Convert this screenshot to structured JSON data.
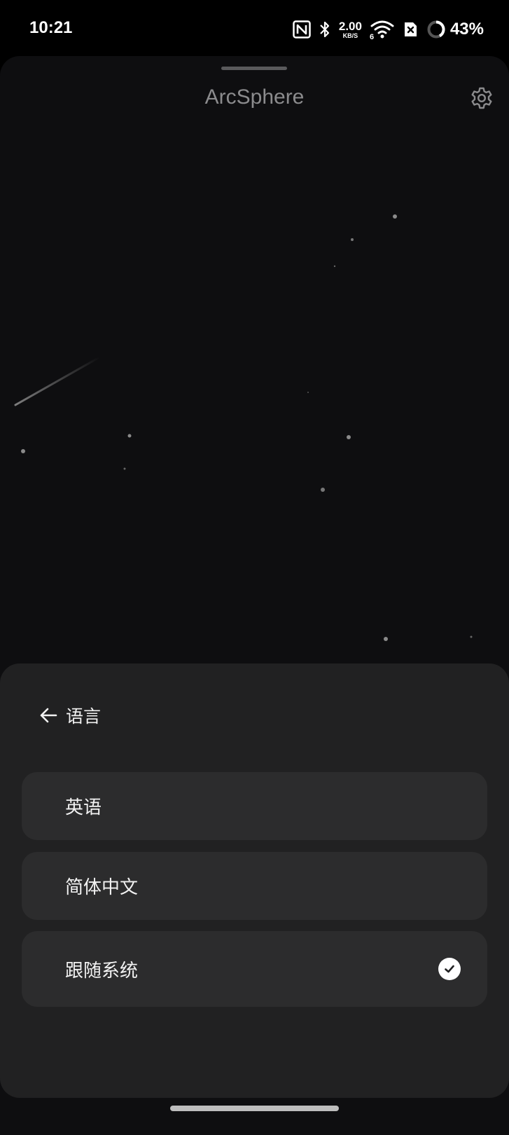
{
  "status_bar": {
    "time": "10:21",
    "net_speed_value": "2.00",
    "net_speed_unit": "KB/S",
    "wifi_generation": "6",
    "battery_percent": "43%",
    "icons": [
      "nfc-icon",
      "bluetooth-icon",
      "wifi-icon",
      "sim-disabled-icon",
      "battery-ring-icon"
    ]
  },
  "app": {
    "title": "ArcSphere",
    "settings_icon": "gear-icon"
  },
  "sheet": {
    "back_icon": "arrow-left-icon",
    "title": "语言",
    "options": [
      {
        "label": "英语",
        "selected": false
      },
      {
        "label": "简体中文",
        "selected": false
      },
      {
        "label": "跟随系统",
        "selected": true
      }
    ],
    "selected_icon": "check-circle-icon"
  },
  "colors": {
    "background": "#0e0e10",
    "sheet": "#212122",
    "option": "#2c2c2d",
    "title_muted": "#8b8b8d"
  }
}
